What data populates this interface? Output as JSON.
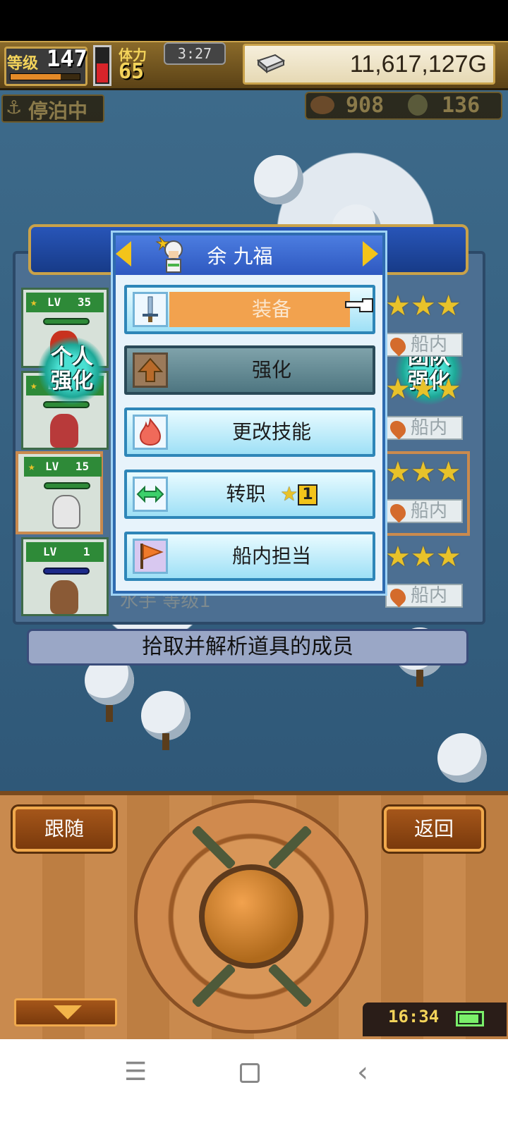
{
  "status": {
    "level_label": "等级",
    "level_value": "147",
    "exp_progress": 0.72,
    "stamina_progress": 0.55,
    "stamina_label": "体力",
    "stamina_value": "65",
    "timer": "3:27",
    "gold": "11,617,127G"
  },
  "world": {
    "anchor_label": "停泊中",
    "resource1_value": "908",
    "resource2_value": "136"
  },
  "crew": {
    "cards": [
      {
        "lv_label": "LV",
        "lv_value": "35"
      },
      {
        "lv_label": "LV",
        "lv_value": ""
      },
      {
        "lv_label": "LV",
        "lv_value": "15"
      },
      {
        "lv_label": "LV",
        "lv_value": "1"
      }
    ],
    "location_label": "船内",
    "personal_boost": "个人\n强化",
    "team_boost": "团队\n强化",
    "faded_name": "水手 等级1",
    "description": "拾取并解析道具的成员"
  },
  "menu": {
    "character_name": "余 九福",
    "options": [
      {
        "label": "装备",
        "icon": "sword-icon",
        "state": "selected"
      },
      {
        "label": "强化",
        "icon": "upgrade-arrow-icon",
        "state": "disabled"
      },
      {
        "label": "更改技能",
        "icon": "flame-icon",
        "state": "normal"
      },
      {
        "label": "转职",
        "icon": "swap-arrows-icon",
        "state": "normal",
        "badge": "1"
      },
      {
        "label": "船内担当",
        "icon": "flag-icon",
        "state": "normal"
      }
    ]
  },
  "controls": {
    "follow_label": "跟随",
    "back_label": "返回",
    "system_time": "16:34",
    "battery_level": 0.85
  },
  "colors": {
    "accent_gold": "#c9a24a",
    "menu_blue": "#2e6bb0",
    "selected_orange": "#f2a24e",
    "wood": "#c98a4e"
  }
}
